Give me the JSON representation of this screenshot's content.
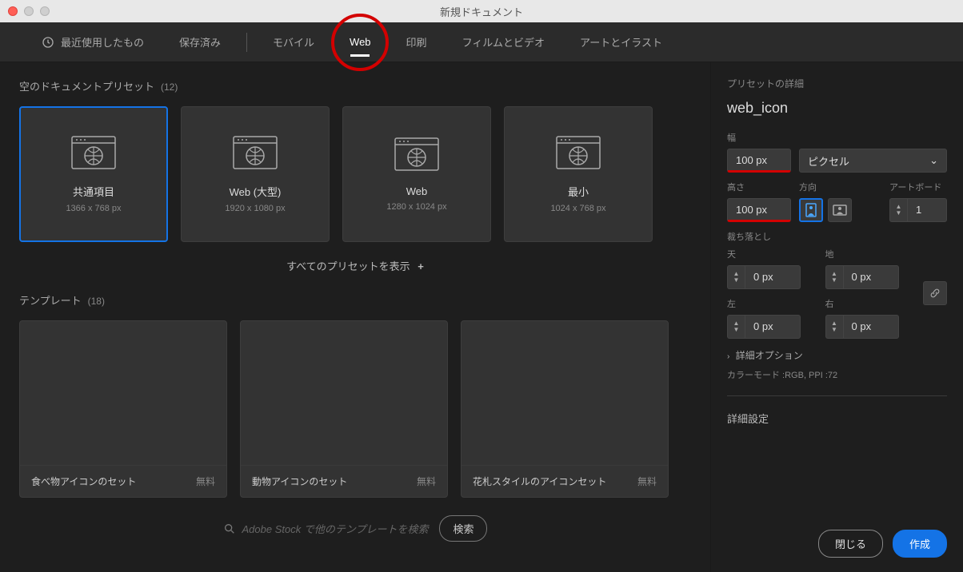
{
  "window": {
    "title": "新規ドキュメント"
  },
  "tabs": {
    "recent": "最近使用したもの",
    "saved": "保存済み",
    "mobile": "モバイル",
    "web": "Web",
    "print": "印刷",
    "film": "フィルムとビデオ",
    "art": "アートとイラスト"
  },
  "sections": {
    "presets_label": "空のドキュメントプリセット",
    "presets_count": "(12)",
    "templates_label": "テンプレート",
    "templates_count": "(18)",
    "show_all": "すべてのプリセットを表示"
  },
  "presets": [
    {
      "name": "共通項目",
      "dims": "1366 x 768 px"
    },
    {
      "name": "Web (大型)",
      "dims": "1920 x 1080 px"
    },
    {
      "name": "Web",
      "dims": "1280 x 1024 px"
    },
    {
      "name": "最小",
      "dims": "1024 x 768 px"
    }
  ],
  "templates": [
    {
      "name": "食べ物アイコンのセット",
      "price": "無料"
    },
    {
      "name": "動物アイコンのセット",
      "price": "無料"
    },
    {
      "name": "花札スタイルのアイコンセット",
      "price": "無料"
    }
  ],
  "search": {
    "placeholder": "Adobe Stock で他のテンプレートを検索",
    "button": "検索"
  },
  "details": {
    "header": "プリセットの詳細",
    "name": "web_icon",
    "width_label": "幅",
    "width_value": "100 px",
    "unit": "ピクセル",
    "height_label": "高さ",
    "height_value": "100 px",
    "orient_label": "方向",
    "artboard_label": "アートボード",
    "artboard_value": "1",
    "bleed_label": "裁ち落とし",
    "bleed_top_label": "天",
    "bleed_bottom_label": "地",
    "bleed_left_label": "左",
    "bleed_right_label": "右",
    "bleed_value": "0 px",
    "adv_options": "詳細オプション",
    "color_mode": "カラーモード :RGB, PPI :72",
    "adv_settings": "詳細設定"
  },
  "buttons": {
    "close": "閉じる",
    "create": "作成"
  }
}
